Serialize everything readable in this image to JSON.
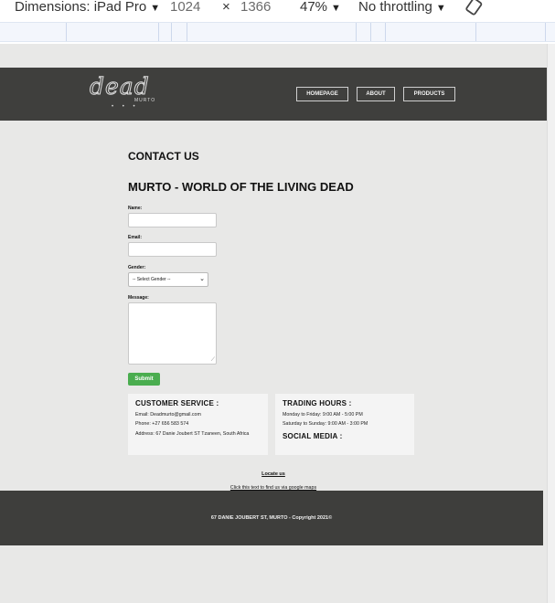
{
  "devtools": {
    "dimensions_label": "Dimensions: iPad Pro",
    "width": "1024",
    "times": "×",
    "height": "1366",
    "zoom": "47%",
    "throttling": "No throttling"
  },
  "header": {
    "logo_text": "dead",
    "logo_sub": "MURTO",
    "nav": [
      "HOMEPAGE",
      "ABOUT",
      "PRODUCTS"
    ]
  },
  "main": {
    "contact_heading": "CONTACT US",
    "murto_heading": "MURTO - WORLD OF THE LIVING DEAD",
    "form": {
      "name_label": "Name:",
      "email_label": "Email:",
      "gender_label": "Gender:",
      "gender_selected": "-- Select Gender --",
      "message_label": "Message:",
      "submit_label": "Submit"
    },
    "customer_service": {
      "title": "CUSTOMER SERVICE :",
      "email": "Email: Deadmurto@gmail.com",
      "phone": "Phone: +27 656 583 574",
      "address": "Address: 67 Danie Joubert ST Tzaneen, South Africa"
    },
    "trading_hours": {
      "title": "TRADING HOURS :",
      "weekdays": "Monday to Friday: 9:00 AM - 5:00 PM",
      "weekend": "Saturday to Sunday: 9:00 AM - 3:00 PM",
      "social_title": "SOCIAL MEDIA :"
    },
    "locate_heading": "Locate us",
    "maps_link": "Click this text to find us via google maps"
  },
  "footer": {
    "text": "67 DANIE JOUBERT ST, MURTO - Copyright 2021©"
  },
  "colors": {
    "header_bg": "#3f3f3d",
    "page_bg": "#e8e8e7",
    "submit_bg": "#4aad4f"
  }
}
